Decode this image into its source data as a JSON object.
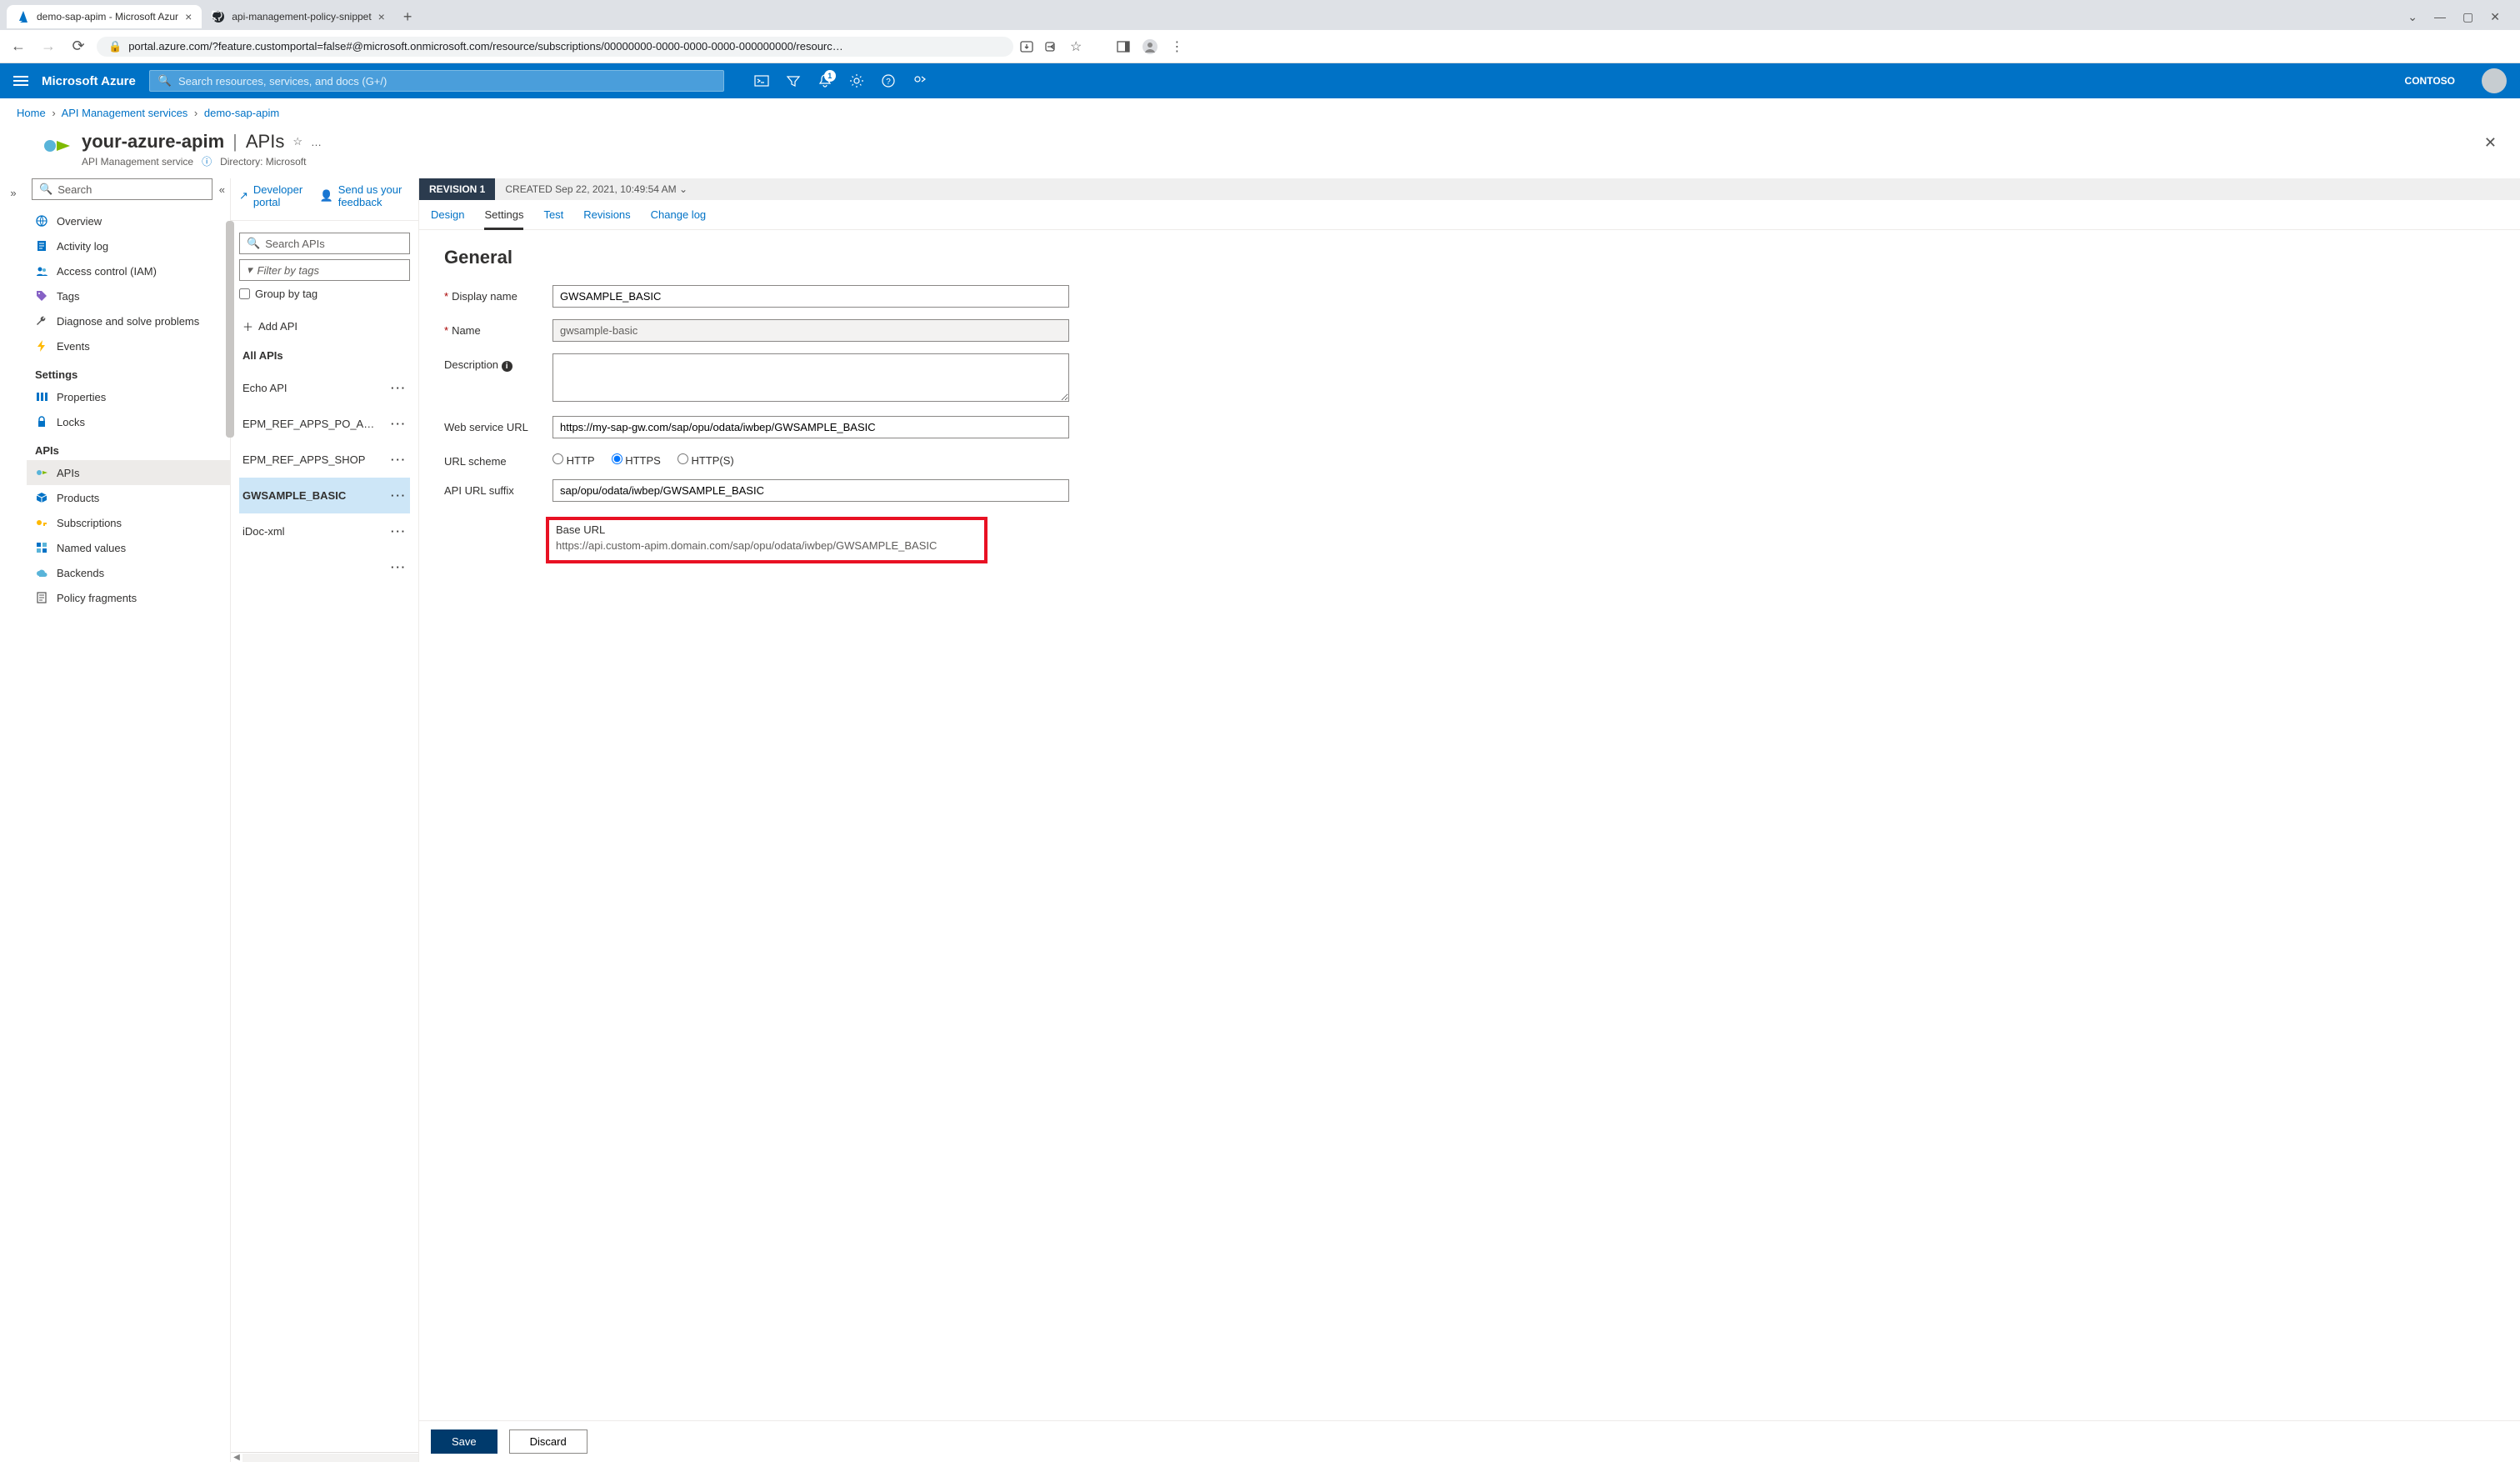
{
  "browser": {
    "tabs": [
      {
        "title": "demo-sap-apim - Microsoft Azur",
        "active": true,
        "favicon": "azure"
      },
      {
        "title": "api-management-policy-snippet",
        "active": false,
        "favicon": "github"
      }
    ],
    "url_display": "portal.azure.com/?feature.customportal=false#@microsoft.onmicrosoft.com/resource/subscriptions/00000000-0000-0000-0000-000000000/resourc…"
  },
  "azure_bar": {
    "brand": "Microsoft Azure",
    "search_placeholder": "Search resources, services, and docs (G+/)",
    "notification_count": "1",
    "tenant": "CONTOSO"
  },
  "breadcrumb": {
    "items": [
      "Home",
      "API Management services",
      "demo-sap-apim"
    ]
  },
  "resource": {
    "title": "your-azure-apim",
    "section": "APIs",
    "subtitle": "API Management service",
    "directory_label": "Directory: Microsoft"
  },
  "sidebar": {
    "search_placeholder": "Search",
    "items": [
      {
        "label": "Overview",
        "icon": "globe",
        "group": null
      },
      {
        "label": "Activity log",
        "icon": "log",
        "group": null
      },
      {
        "label": "Access control (IAM)",
        "icon": "people",
        "group": null
      },
      {
        "label": "Tags",
        "icon": "tag",
        "group": null
      },
      {
        "label": "Diagnose and solve problems",
        "icon": "wrench",
        "group": null
      },
      {
        "label": "Events",
        "icon": "bolt",
        "group": null
      },
      {
        "label": "Properties",
        "icon": "props",
        "group": "Settings"
      },
      {
        "label": "Locks",
        "icon": "lock",
        "group": "Settings"
      },
      {
        "label": "APIs",
        "icon": "api",
        "group": "APIs",
        "active": true
      },
      {
        "label": "Products",
        "icon": "product",
        "group": "APIs"
      },
      {
        "label": "Subscriptions",
        "icon": "key",
        "group": "APIs"
      },
      {
        "label": "Named values",
        "icon": "grid",
        "group": "APIs"
      },
      {
        "label": "Backends",
        "icon": "cloud",
        "group": "APIs"
      },
      {
        "label": "Policy fragments",
        "icon": "policy",
        "group": "APIs"
      }
    ],
    "group_settings": "Settings",
    "group_apis": "APIs"
  },
  "mid": {
    "toolbar": {
      "developer_portal": "Developer portal",
      "feedback": "Send us your feedback"
    },
    "search_placeholder": "Search APIs",
    "filter_placeholder": "Filter by tags",
    "group_by_tag": "Group by tag",
    "add_api": "Add API",
    "all_apis_heading": "All APIs",
    "apis": [
      {
        "label": "Echo API"
      },
      {
        "label": "EPM_REF_APPS_PO_A…"
      },
      {
        "label": "EPM_REF_APPS_SHOP"
      },
      {
        "label": "GWSAMPLE_BASIC",
        "selected": true
      },
      {
        "label": "iDoc-xml"
      },
      {
        "label": ""
      }
    ]
  },
  "detail": {
    "revision_badge": "REVISION 1",
    "revision_meta_prefix": "CREATED",
    "revision_meta": "Sep 22, 2021, 10:49:54 AM",
    "tabs": [
      "Design",
      "Settings",
      "Test",
      "Revisions",
      "Change log"
    ],
    "active_tab": "Settings",
    "heading": "General",
    "fields": {
      "display_name": {
        "label": "Display name",
        "value": "GWSAMPLE_BASIC",
        "required": true
      },
      "name": {
        "label": "Name",
        "value": "gwsample-basic",
        "required": true,
        "readonly": true
      },
      "description": {
        "label": "Description",
        "value": ""
      },
      "web_service_url": {
        "label": "Web service URL",
        "value": "https://my-sap-gw.com/sap/opu/odata/iwbep/GWSAMPLE_BASIC"
      },
      "url_scheme": {
        "label": "URL scheme",
        "options": [
          "HTTP",
          "HTTPS",
          "HTTP(S)"
        ],
        "selected": "HTTPS"
      },
      "api_url_suffix": {
        "label": "API URL suffix",
        "value": "sap/opu/odata/iwbep/GWSAMPLE_BASIC"
      },
      "base_url": {
        "label": "Base URL",
        "value": "https://api.custom-apim.domain.com/sap/opu/odata/iwbep/GWSAMPLE_BASIC"
      }
    },
    "buttons": {
      "save": "Save",
      "discard": "Discard"
    }
  }
}
